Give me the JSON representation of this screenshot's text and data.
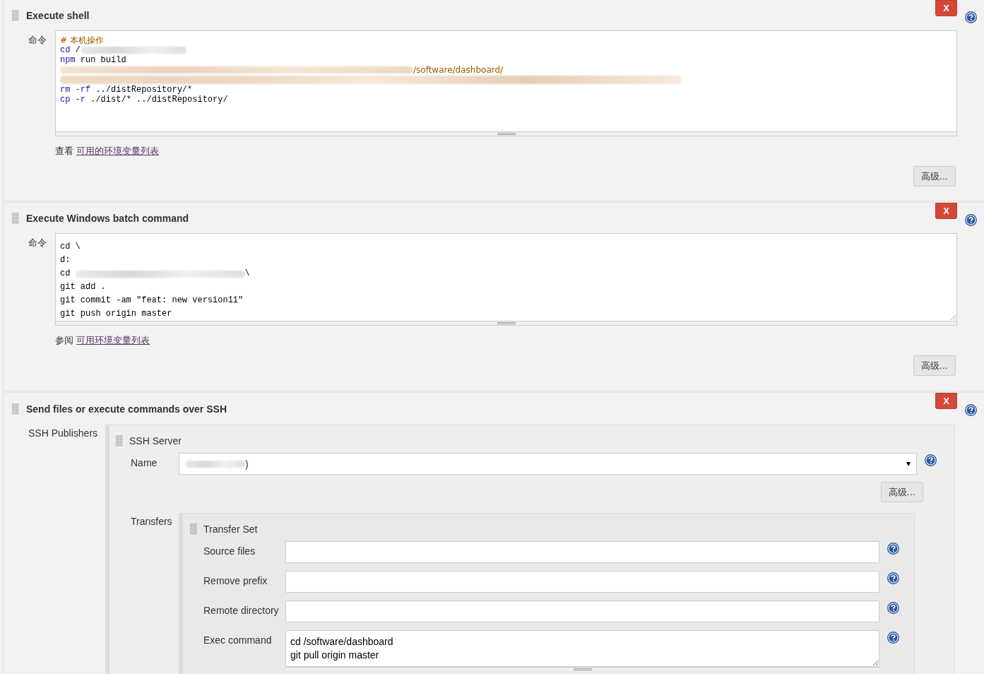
{
  "sections": [
    {
      "kind": "shell",
      "title": "Execute shell",
      "delete_button": "X",
      "field_label": "命令",
      "editor": {
        "kind": "highlighted",
        "lines": [
          [
            {
              "kind": "comment",
              "t": "# 本机操作"
            }
          ],
          [
            {
              "kind": "keyword",
              "t": "cd"
            },
            {
              "kind": "plain",
              "t": " /"
            },
            {
              "kind": "blurred"
            }
          ],
          [
            {
              "kind": "keyword",
              "t": "npm"
            },
            {
              "kind": "plain",
              "t": " run build"
            }
          ],
          [
            {
              "kind": "blurred"
            },
            {
              "kind": "comment",
              "t": "/software/dashboard/"
            }
          ],
          [
            {
              "kind": "blurred"
            }
          ],
          [
            {
              "kind": "keyword",
              "t": "rm -rf"
            },
            {
              "kind": "plain",
              "t": " ../distRepository/*"
            }
          ],
          [
            {
              "kind": "keyword",
              "t": "cp -r"
            },
            {
              "kind": "plain",
              "t": " ./dist/* ../distRepository/"
            }
          ]
        ]
      },
      "hint_prefix": "查看",
      "hint_link": "可用的环境变量列表",
      "advanced_button": "高级..."
    },
    {
      "kind": "batch",
      "title": "Execute Windows batch command",
      "delete_button": "X",
      "field_label": "命令",
      "editor": {
        "kind": "plain",
        "lines": [
          [
            {
              "kind": "plain",
              "t": "cd \\"
            }
          ],
          [
            {
              "kind": "plain",
              "t": "d:"
            }
          ],
          [
            {
              "kind": "plain",
              "t": "cd "
            },
            {
              "kind": "blurred"
            },
            {
              "kind": "plain",
              "t": "\\"
            }
          ],
          [
            {
              "kind": "plain",
              "t": "git add ."
            }
          ],
          [
            {
              "kind": "plain",
              "t": "git commit -am ″feat: new version11″"
            }
          ],
          [
            {
              "kind": "plain",
              "t": "git push origin master"
            }
          ]
        ]
      },
      "hint_prefix": "参阅",
      "hint_link": "可用环境变量列表",
      "advanced_button": "高级..."
    },
    {
      "kind": "ssh",
      "title": "Send files or execute commands over SSH",
      "delete_button": "X",
      "publishers_label": "SSH Publishers",
      "server": {
        "title": "SSH Server",
        "name_label": "Name",
        "name_value": ")",
        "advanced_button": "高级...",
        "transfers_label": "Transfers",
        "transfer_set": {
          "title": "Transfer Set",
          "fields": [
            {
              "kind": "input",
              "label": "Source files"
            },
            {
              "kind": "input",
              "label": "Remove prefix"
            },
            {
              "kind": "input",
              "label": "Remote directory"
            },
            {
              "kind": "textarea",
              "label": "Exec command",
              "value": "cd /software/dashboard\ngit pull origin master"
            }
          ]
        }
      }
    }
  ]
}
